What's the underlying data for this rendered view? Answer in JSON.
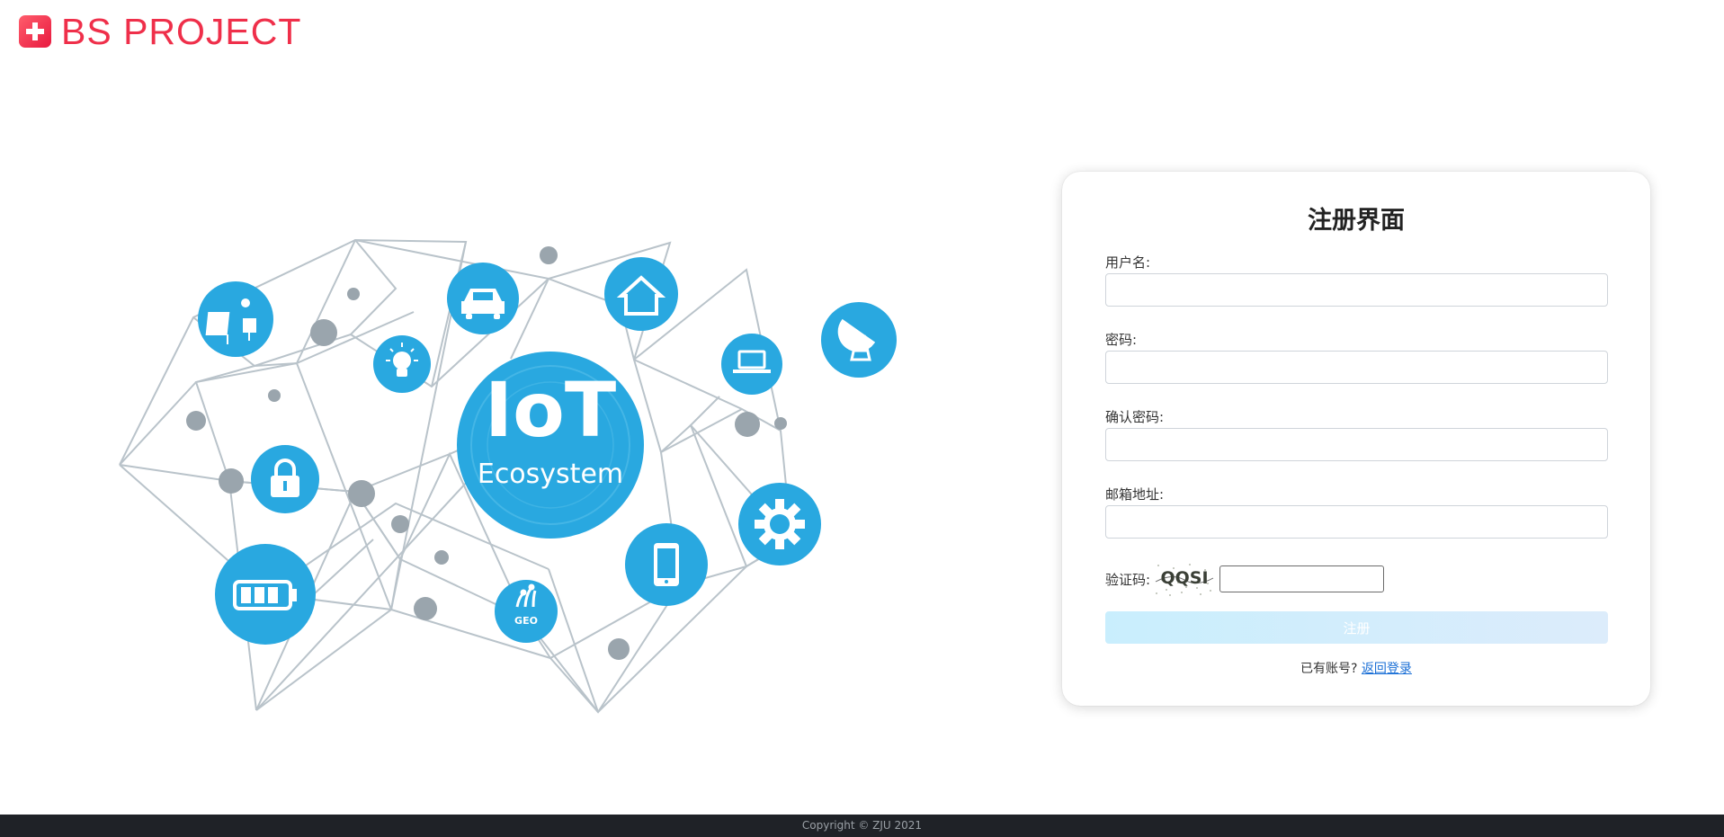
{
  "brand": {
    "name": "BS PROJECT",
    "color": "#ef2f4a",
    "icon": "plus-cross-icon"
  },
  "illustration": {
    "title": "IoT",
    "subtitle": "Ecosystem",
    "accent": "#29a8e0",
    "node_color": "#9aa5ad",
    "icons": [
      "solar-panel-icon",
      "lightbulb-icon",
      "car-icon",
      "home-icon",
      "laptop-icon",
      "satellite-dish-icon",
      "lock-icon",
      "battery-icon",
      "gear-icon",
      "smartphone-icon",
      "geo-icon"
    ],
    "geo_label": "GEO"
  },
  "form": {
    "title": "注册界面",
    "username_label": "用户名:",
    "password_label": "密码:",
    "confirm_label": "确认密码:",
    "email_label": "邮箱地址:",
    "captcha_label": "验证码:",
    "captcha_text": "QQSI",
    "submit_label": "注册",
    "has_account_text": "已有账号? ",
    "back_login_label": "返回登录",
    "button_color": "#c9eefd",
    "link_color": "#1a6fd6"
  },
  "footer": {
    "copyright": "Copyright © ZJU 2021"
  }
}
